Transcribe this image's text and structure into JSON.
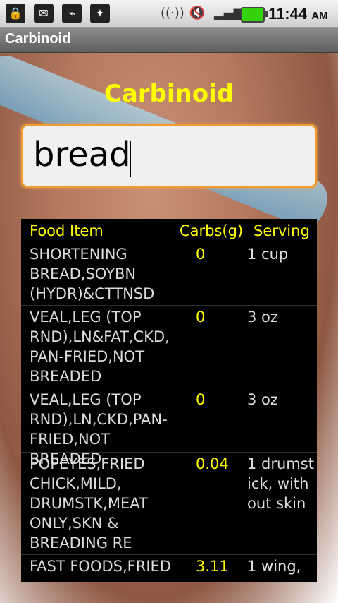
{
  "status_bar": {
    "time": "11:44",
    "ampm": "AM",
    "icons": [
      "sd-card-lock-icon",
      "mail-at-icon",
      "usb-icon",
      "android-debug-icon",
      "wifi-icon",
      "mute-icon",
      "signal-icon",
      "battery-icon"
    ]
  },
  "titlebar": {
    "title": "Carbinoid"
  },
  "main": {
    "heading": "Carbinoid",
    "search": {
      "value": "bread"
    }
  },
  "table": {
    "headers": [
      "Food Item",
      "Carbs(g)",
      "Serving"
    ],
    "rows": [
      {
        "item": "SHORTENING BREAD,SOYBN (HYDR)&CTTNSD",
        "carbs": "0",
        "serving": "1 cup"
      },
      {
        "item": "VEAL,LEG (TOP RND),LN&FAT,CKD, PAN-FRIED,NOT BREADED",
        "carbs": "0",
        "serving": "3 oz"
      },
      {
        "item": "VEAL,LEG (TOP RND),LN,CKD,PAN-FRIED,NOT BREADED",
        "carbs": "0",
        "serving": "3 oz"
      },
      {
        "item": "POPEYES,FRIED CHICK,MILD, DRUMSTK,MEAT ONLY,SKN & BREADING RE",
        "carbs": "0.04",
        "serving": "1 drumstick, without skin"
      },
      {
        "item": "FAST FOODS,FRIED",
        "carbs": "3.11",
        "serving": "1 wing,"
      }
    ]
  },
  "colors": {
    "accent": "#ffff00",
    "focus_border": "#f09b2d"
  }
}
